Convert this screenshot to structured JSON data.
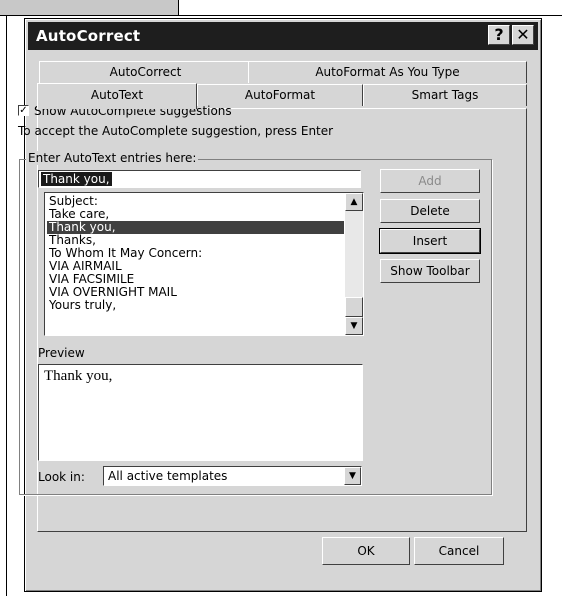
{
  "dialog": {
    "title": "AutoCorrect",
    "help_glyph": "?",
    "close_glyph": "✕"
  },
  "tabs": {
    "autocorrect": "AutoCorrect",
    "autoformat_as_you_type": "AutoFormat As You Type",
    "autotext": "AutoText",
    "autoformat": "AutoFormat",
    "smart_tags": "Smart Tags"
  },
  "autocomplete": {
    "checkbox_label": "Show AutoComplete suggestions",
    "checked": true,
    "hint": "To accept the AutoComplete suggestion, press Enter"
  },
  "entries": {
    "group_label": "Enter AutoText entries here:",
    "input_value": "Thank you,",
    "items": [
      "Subject:",
      "Take care,",
      "Thank you,",
      "Thanks,",
      "To Whom It May Concern:",
      "VIA AIRMAIL",
      "VIA FACSIMILE",
      "VIA OVERNIGHT MAIL",
      "Yours truly,"
    ],
    "selected_index": 2
  },
  "buttons": {
    "add": "Add",
    "delete": "Delete",
    "insert": "Insert",
    "show_toolbar": "Show Toolbar",
    "ok": "OK",
    "cancel": "Cancel"
  },
  "preview": {
    "label": "Preview",
    "text": "Thank you,"
  },
  "lookin": {
    "label": "Look in:",
    "value": "All active templates"
  },
  "scroll_glyphs": {
    "up": "▲",
    "down": "▼"
  }
}
